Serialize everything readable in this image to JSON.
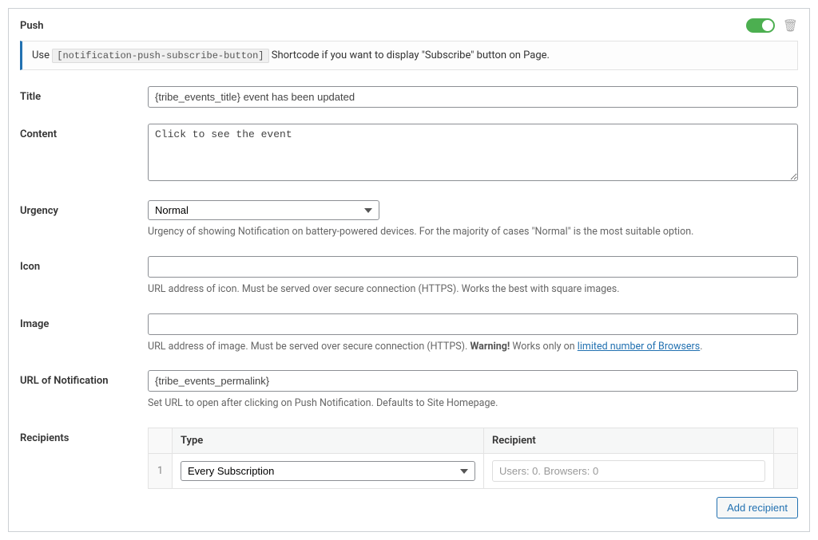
{
  "panel": {
    "title": "Push",
    "toggle_on": true
  },
  "info": {
    "prefix": "Use ",
    "shortcode": "[notification-push-subscribe-button]",
    "suffix": " Shortcode if you want to display \"Subscribe\" button on Page."
  },
  "fields": {
    "title": {
      "label": "Title",
      "value": "{tribe_events_title} event has been updated"
    },
    "content": {
      "label": "Content",
      "value": "Click to see the event"
    },
    "urgency": {
      "label": "Urgency",
      "value": "Normal",
      "help": "Urgency of showing Notification on battery-powered devices. For the majority of cases \"Normal\" is the most suitable option."
    },
    "icon": {
      "label": "Icon",
      "value": "",
      "help": "URL address of icon. Must be served over secure connection (HTTPS). Works the best with square images."
    },
    "image": {
      "label": "Image",
      "value": "",
      "help_prefix": "URL address of image. Must be served over secure connection (HTTPS). ",
      "help_warning_label": "Warning!",
      "help_middle": " Works only on ",
      "help_link_text": "limited number of Browsers",
      "help_suffix": "."
    },
    "url": {
      "label": "URL of Notification",
      "value": "{tribe_events_permalink}",
      "help": "Set URL to open after clicking on Push Notification. Defaults to Site Homepage."
    },
    "recipients": {
      "label": "Recipients",
      "headers": {
        "type": "Type",
        "recipient": "Recipient"
      },
      "rows": [
        {
          "num": "1",
          "type": "Every Subscription",
          "recipient": "Users: 0. Browsers: 0"
        }
      ],
      "add_btn": "Add recipient"
    }
  }
}
